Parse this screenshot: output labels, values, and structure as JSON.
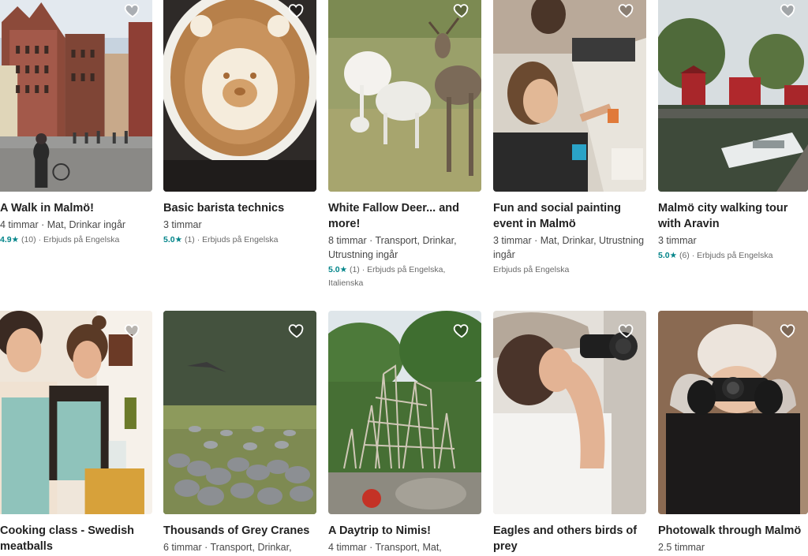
{
  "favorite_icon": "heart-outline-icon",
  "accent_color": "#008489",
  "listings": [
    {
      "title": "A Walk in Malmö!",
      "meta": "4 timmar · Mat, Drinkar ingår",
      "rating": "4.9",
      "reviews": "(10)",
      "languages": "· Erbjuds på Engelska"
    },
    {
      "title": "Basic barista technics",
      "meta": "3 timmar",
      "rating": "5.0",
      "reviews": "(1)",
      "languages": "· Erbjuds på Engelska"
    },
    {
      "title": "White Fallow Deer... and more!",
      "meta": "8 timmar · Transport, Drinkar, Utrustning ingår",
      "rating": "5.0",
      "reviews": "(1)",
      "languages": "· Erbjuds på Engelska, Italienska"
    },
    {
      "title": "Fun and social painting event in Malmö",
      "meta": "3 timmar · Mat, Drinkar, Utrustning ingår",
      "rating": "",
      "reviews": "",
      "languages": "Erbjuds på Engelska"
    },
    {
      "title": "Malmö city walking tour with Aravin",
      "meta": "3 timmar",
      "rating": "5.0",
      "reviews": "(6)",
      "languages": "· Erbjuds på Engelska"
    },
    {
      "title": "Cooking class - Swedish meatballs",
      "meta": ""
    },
    {
      "title": "Thousands of Grey Cranes",
      "meta": "6 timmar · Transport, Drinkar,"
    },
    {
      "title": "A Daytrip to Nimis!",
      "meta": "4 timmar · Transport, Mat,"
    },
    {
      "title": "Eagles and others birds of prey",
      "meta": ""
    },
    {
      "title": "Photowalk through Malmö",
      "meta": "2.5 timmar"
    }
  ]
}
